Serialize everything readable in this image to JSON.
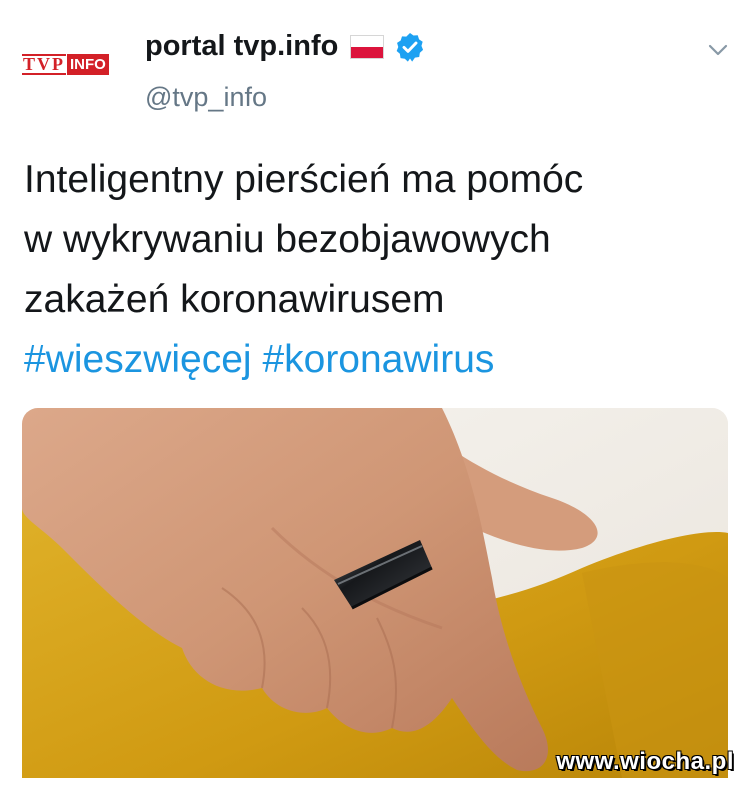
{
  "tweet": {
    "avatar": {
      "logo_left": "TVP",
      "logo_right": "INFO"
    },
    "display_name": "portal tvp.info",
    "handle": "@tvp_info",
    "text_lines": [
      "Inteligentny pierścień ma pomóc",
      "w wykrywaniu bezobjawowych",
      "zakażeń koronawirusem"
    ],
    "hashtags": [
      "#wieszwięcej",
      "#koronawirus"
    ],
    "icons": {
      "flag": "poland-flag-icon",
      "verified": "verified-badge-icon",
      "menu": "chevron-down-icon"
    },
    "media": {
      "subject": "hand wearing black smart ring on yellow fabric"
    }
  },
  "watermark": "www.wiocha.pl",
  "colors": {
    "text": "#14171a",
    "secondary": "#657786",
    "link": "#1b95e0",
    "verified": "#1da1f2",
    "tvp_red": "#d32027",
    "flag_red": "#dc143c"
  }
}
